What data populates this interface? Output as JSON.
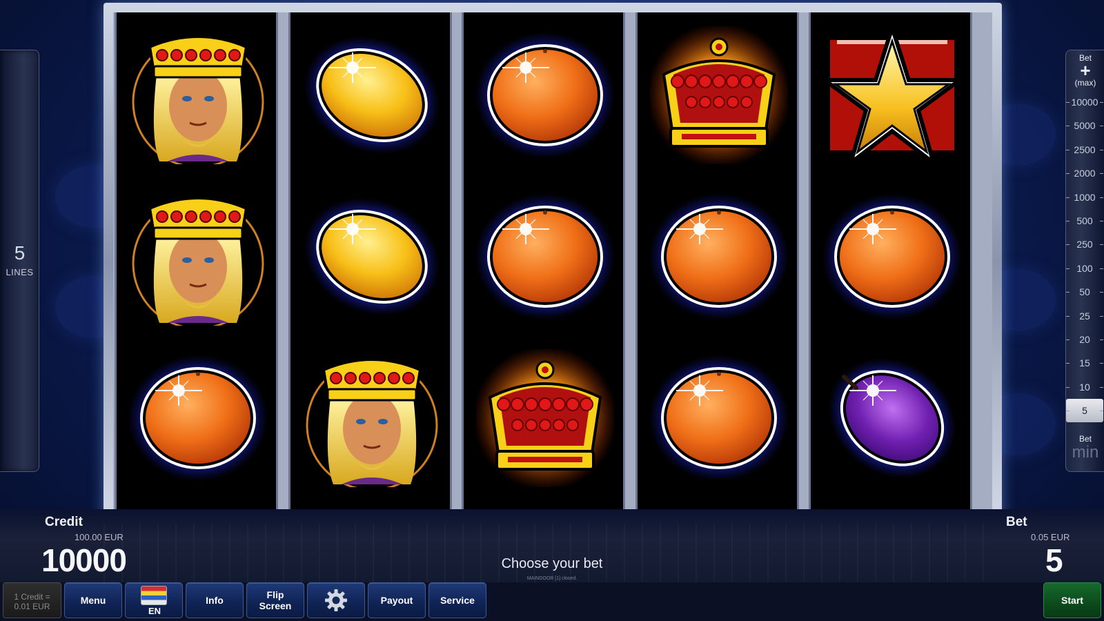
{
  "lines_panel": {
    "count": "5",
    "label": "LINES"
  },
  "bet_panel": {
    "max_label_top": "Bet",
    "max_label_bottom": "(max)",
    "scale": [
      "10000",
      "5000",
      "2500",
      "2000",
      "1000",
      "500",
      "250",
      "100",
      "50",
      "25",
      "20",
      "15",
      "10",
      "5"
    ],
    "selected": "5",
    "min_label_top": "Bet",
    "min_label_bottom": "min"
  },
  "reels": [
    [
      "king",
      "king",
      "orange"
    ],
    [
      "lemon",
      "lemon",
      "king"
    ],
    [
      "orange",
      "orange",
      "crown"
    ],
    [
      "crown",
      "orange",
      "orange"
    ],
    [
      "star",
      "orange",
      "plum"
    ]
  ],
  "credit": {
    "title": "Credit",
    "eur": "100.00 EUR",
    "value": "10000"
  },
  "bet": {
    "title": "Bet",
    "eur": "0.05 EUR",
    "value": "5"
  },
  "status": {
    "message": "Choose your bet",
    "sub": "MAINDOOR [1] closed."
  },
  "buttons": {
    "credit_rate_line1": "1 Credit =",
    "credit_rate_line2": "0.01 EUR",
    "menu": "Menu",
    "language": "EN",
    "info": "Info",
    "flip_line1": "Flip",
    "flip_line2": "Screen",
    "settings_icon": "gear-icon",
    "payout": "Payout",
    "service": "Service",
    "start": "Start"
  },
  "colors": {
    "background": "#0b1c52",
    "button_blue": "#102456",
    "start_green": "#0c4a1c"
  }
}
